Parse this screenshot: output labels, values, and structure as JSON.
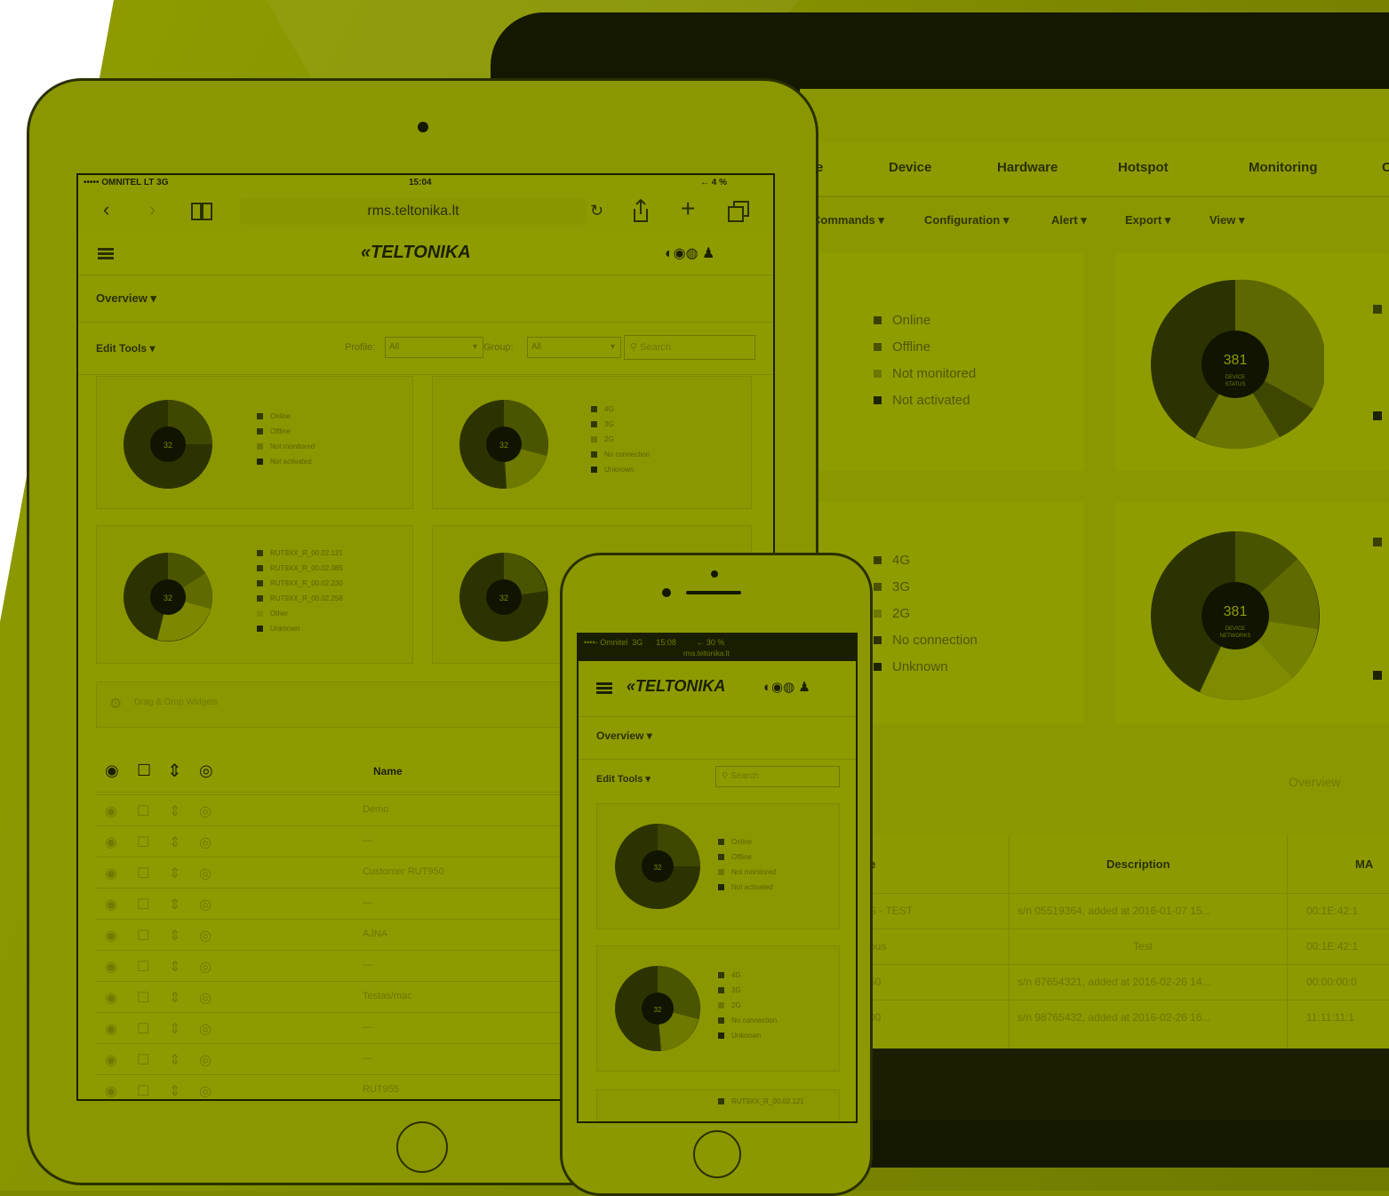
{
  "colors": {
    "accent": "#8a9700",
    "dark": "#1c2000",
    "text": "#2a3000"
  },
  "laptop": {
    "nav": [
      "e",
      "Device",
      "Hardware",
      "Hotspot",
      "Monitoring",
      "C"
    ],
    "subnav": [
      "Commands ▾",
      "Configuration ▾",
      "Alert ▾",
      "Export ▾",
      "View ▾"
    ],
    "status_legend": [
      "Online",
      "Offline",
      "Not monitored",
      "Not activated"
    ],
    "network_legend": [
      "4G",
      "3G",
      "2G",
      "No connection",
      "Unknown"
    ],
    "donut1_value": "381",
    "donut1_sub": "DEVICE\nSTATUS",
    "donut2_value": "381",
    "donut2_sub": "DEVICE\nNETWORKS",
    "overview_tab": "Overview",
    "table": {
      "headers": [
        "e",
        "Description",
        "MA"
      ],
      "rows": [
        [
          "S - TEST",
          "s/n 05519364, added at 2016-01-07 15...",
          "00:1E:42:1"
        ],
        [
          "ous",
          "Test",
          "00:1E:42:1"
        ],
        [
          "50",
          "s/n 87654321, added at 2016-02-26 14...",
          "00:00:00:0"
        ],
        [
          "00",
          "s/n 98765432, added at 2016-02-26 16...",
          "11:11:11:1"
        ]
      ]
    }
  },
  "tablet": {
    "status_left": "••••• OMNITEL LT  3G",
    "status_time": "15:04",
    "status_right": "← 4 %",
    "url": "rms.teltonika.lt",
    "logo": "TELTONIKA",
    "overview": "Overview ▾",
    "edit_tools": "Edit Tools ▾",
    "profile_label": "Profile:",
    "profile_value": "All",
    "group_label": "Group:",
    "group_value": "All",
    "search_placeholder": "Search",
    "card1_legend": [
      "Online",
      "Offline",
      "Not monitored",
      "Not activated"
    ],
    "card2_legend": [
      "4G",
      "3G",
      "2G",
      "No connection",
      "Unknown"
    ],
    "card3_legend": [
      "RUT9XX_R_00.02.121",
      "RUT9XX_R_00.02.085",
      "RUT9XX_R_00.02.230",
      "RUT9XX_R_00.02.258",
      "Other",
      "Unknown"
    ],
    "donut_value": "32",
    "widget_hint": "Drag & Drop Widgets",
    "name_header": "Name",
    "names": [
      "Demo",
      "—",
      "Customer RUT950",
      "—",
      "AJNA",
      "—",
      "Testas/mac",
      "—",
      "—",
      "RUT955"
    ]
  },
  "phone": {
    "status": "••••◦ Omnitel  3G      15:08         ← 30 %",
    "url": "rms.teltonika.lt",
    "logo": "TELTONIKA",
    "overview": "Overview ▾",
    "edit_tools": "Edit Tools ▾",
    "search_placeholder": "Search",
    "card1_legend": [
      "Online",
      "Offline",
      "Not monitored",
      "Not activated"
    ],
    "card2_legend": [
      "4G",
      "3G",
      "2G",
      "No connection",
      "Unknown"
    ],
    "card3_legend": [
      "RUT9XX_R_00.02.121"
    ],
    "donut_value": "32"
  }
}
